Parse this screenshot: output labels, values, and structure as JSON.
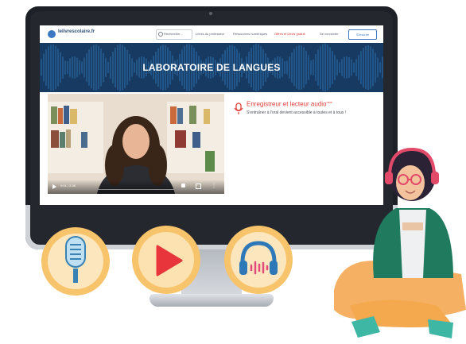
{
  "nav": {
    "logo": "lelivrescolaire.fr",
    "search_placeholder": "Rechercher...",
    "items": [
      "Livres du professeur",
      "Ressources numériques",
      "Offres et Devis gratuit",
      "Se connecter"
    ],
    "signup": "S'inscrire"
  },
  "hero": {
    "title": "LABORATOIRE DE LANGUES"
  },
  "video": {
    "time": "0:01 / 2:28"
  },
  "feature": {
    "title": "Enregistreur et lecteur audio",
    "badge": "new",
    "description": "S'entraîner à l'oral devient accessible à toutes et à tous !"
  },
  "icons": [
    "microphone-icon",
    "play-icon",
    "headphones-audio-icon"
  ],
  "colors": {
    "hero_bg": "#163a61",
    "accent_red": "#e0413a",
    "circle": "#f7c36b",
    "jacket": "#1f7a5e"
  }
}
